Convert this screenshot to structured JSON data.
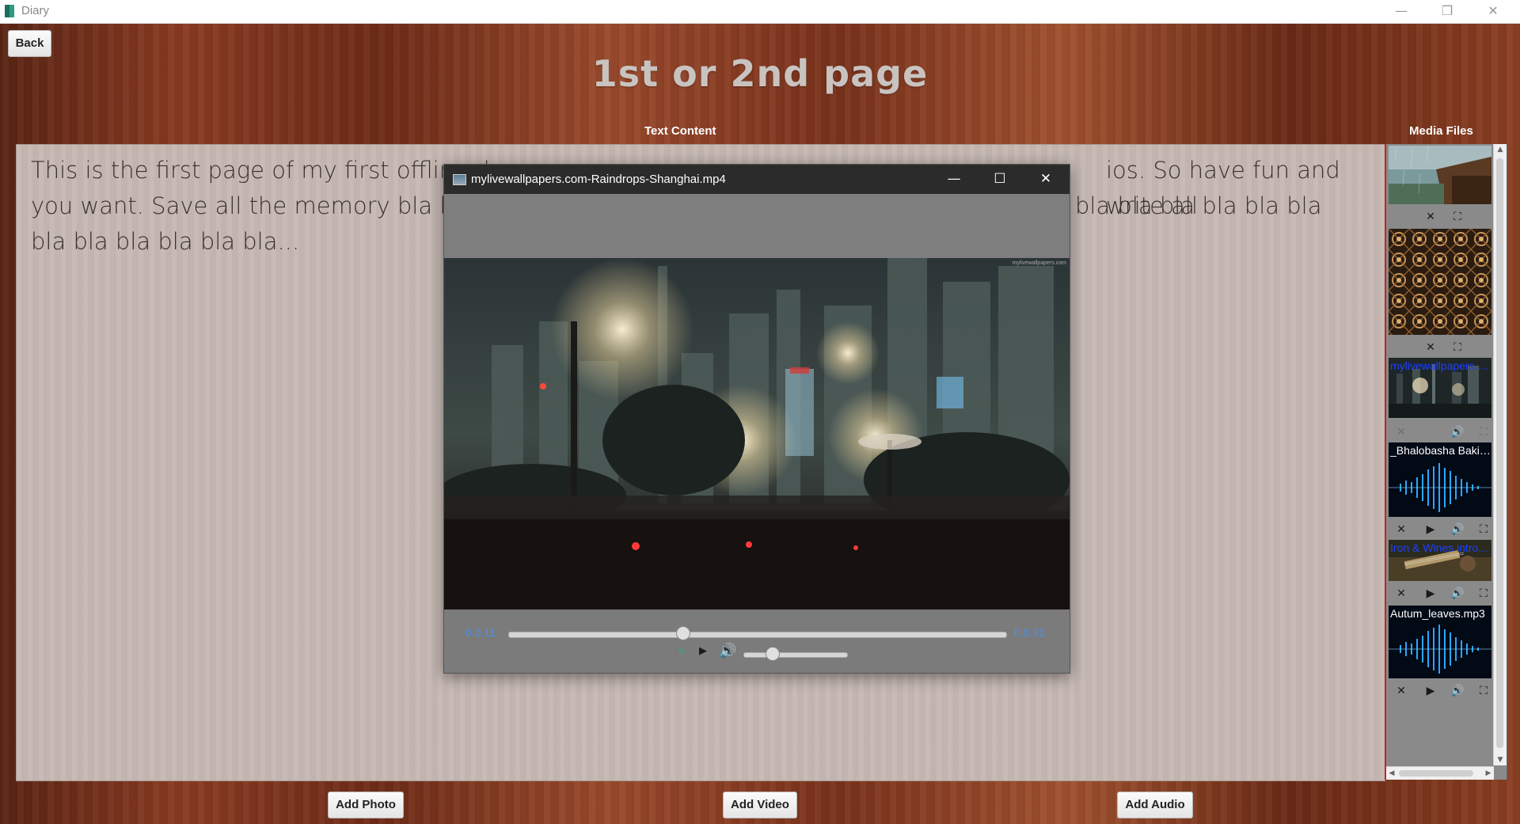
{
  "window": {
    "title": "Diary",
    "minimize": "—",
    "restore": "❐",
    "close": "✕"
  },
  "header": {
    "back_label": "Back",
    "page_title": "1st or 2nd page"
  },
  "text_section": {
    "label": "Text Content",
    "visible_text": "This is the first page of my first offline d",
    "visible_text_right_1": "ios. So have fun and write all",
    "line2_left": "you want. Save all the memory bla bla b",
    "line2_right": "a bla bla bla bla bla bla",
    "line3": "bla bla bla bla bla bla..."
  },
  "media_section": {
    "label": "Media Files",
    "items": [
      {
        "type": "photo",
        "label": "",
        "controls": [
          "close-icon",
          "fullscreen-icon"
        ]
      },
      {
        "type": "photo",
        "label": "",
        "controls": [
          "close-icon",
          "fullscreen-icon"
        ]
      },
      {
        "type": "video",
        "label": "mylivewallpapers.com-Raindrops-Shanghai.mp4",
        "controls": [
          "close-icon",
          "volume-icon",
          "fullscreen-icon"
        ]
      },
      {
        "type": "audio",
        "label": "_Bhalobasha Baki_...",
        "controls": [
          "close-icon",
          "play-icon",
          "volume-icon",
          "fullscreen-icon"
        ]
      },
      {
        "type": "video",
        "label": "Iron & Wines intro...",
        "controls": [
          "close-icon",
          "play-icon",
          "volume-icon",
          "fullscreen-icon"
        ]
      },
      {
        "type": "audio",
        "label": "Autum_leaves.mp3",
        "controls": [
          "close-icon",
          "play-icon",
          "volume-icon",
          "fullscreen-icon"
        ]
      }
    ]
  },
  "video_player": {
    "title": "mylivewallpapers.com-Raindrops-Shanghai.mp4",
    "current_time": "0.0.11",
    "total_time": "0.0.31",
    "seek_fraction": 0.35,
    "volume_fraction": 0.28,
    "watermark": "mylivewallpapers.com"
  },
  "footer": {
    "add_photo": "Add Photo",
    "add_video": "Add Video",
    "add_audio": "Add Audio"
  },
  "colors": {
    "accent_time": "#4f8fe6",
    "video_label": "#1e40ff",
    "audio_label": "#ffffff"
  }
}
